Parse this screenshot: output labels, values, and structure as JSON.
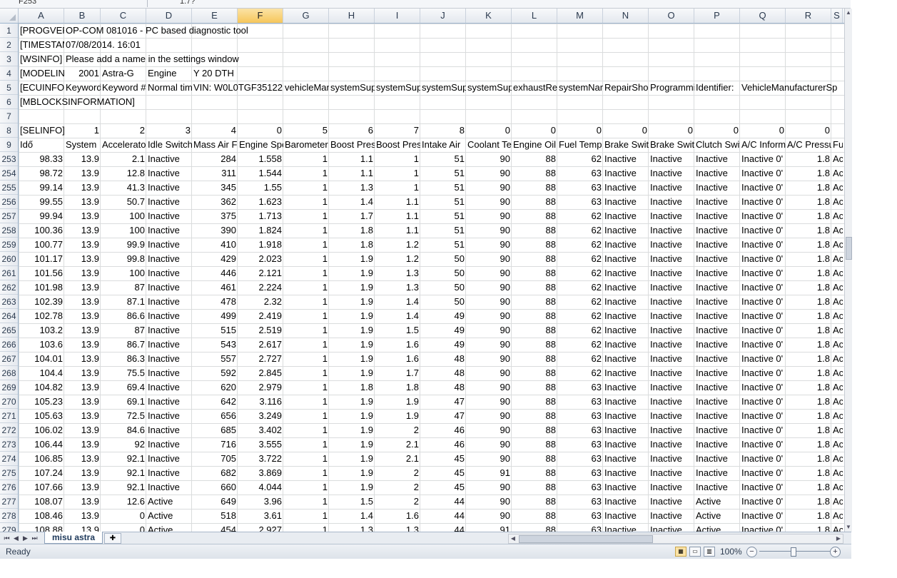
{
  "formula_bar": {
    "name_box": "F253",
    "value": "1.7?"
  },
  "columns": [
    {
      "id": "A",
      "w": 64
    },
    {
      "id": "B",
      "w": 51
    },
    {
      "id": "C",
      "w": 64
    },
    {
      "id": "D",
      "w": 64
    },
    {
      "id": "E",
      "w": 64
    },
    {
      "id": "F",
      "w": 64
    },
    {
      "id": "G",
      "w": 64
    },
    {
      "id": "H",
      "w": 64
    },
    {
      "id": "I",
      "w": 64
    },
    {
      "id": "J",
      "w": 64
    },
    {
      "id": "K",
      "w": 64
    },
    {
      "id": "L",
      "w": 64
    },
    {
      "id": "M",
      "w": 64
    },
    {
      "id": "N",
      "w": 64
    },
    {
      "id": "O",
      "w": 64
    },
    {
      "id": "P",
      "w": 64
    },
    {
      "id": "Q",
      "w": 64
    },
    {
      "id": "R",
      "w": 64
    },
    {
      "id": "S",
      "w": 16
    }
  ],
  "selected_column": "F",
  "top_rows": [
    {
      "num": "1",
      "cells": [
        {
          "col": 0,
          "v": "[PROGVERSION]",
          "t": "txt"
        },
        {
          "col": 1,
          "v": "OP-COM 081016 - PC based diagnostic tool",
          "t": "txt"
        }
      ]
    },
    {
      "num": "2",
      "cells": [
        {
          "col": 0,
          "v": "[TIMESTAMP]",
          "t": "txt"
        },
        {
          "col": 1,
          "v": "07/08/2014. 16:01",
          "t": "txt"
        }
      ]
    },
    {
      "num": "3",
      "cells": [
        {
          "col": 0,
          "v": "[WSINFO]",
          "t": "txt"
        },
        {
          "col": 1,
          "v": "Please add a name in the settings window",
          "t": "txt"
        }
      ]
    },
    {
      "num": "4",
      "cells": [
        {
          "col": 0,
          "v": "[MODELINFO]",
          "t": "txt"
        },
        {
          "col": 1,
          "v": "2001",
          "t": "num"
        },
        {
          "col": 2,
          "v": "Astra-G",
          "t": "txt"
        },
        {
          "col": 3,
          "v": "Engine",
          "t": "txt"
        },
        {
          "col": 4,
          "v": "Y 20 DTH",
          "t": "txt"
        }
      ]
    },
    {
      "num": "5",
      "cells": [
        {
          "col": 0,
          "v": "[ECUINFO]",
          "t": "txt"
        },
        {
          "col": 1,
          "v": "Keyword",
          "t": "txt"
        },
        {
          "col": 2,
          "v": "Keyword #",
          "t": "txt"
        },
        {
          "col": 3,
          "v": "Normal timing",
          "t": "txt"
        },
        {
          "col": 4,
          "v": "VIN: W0L0TGF35122",
          "t": "txt"
        },
        {
          "col": 6,
          "v": "vehicleManufacturer",
          "t": "txt"
        },
        {
          "col": 7,
          "v": "systemSupplier",
          "t": "txt"
        },
        {
          "col": 8,
          "v": "systemSupplier",
          "t": "txt"
        },
        {
          "col": 9,
          "v": "systemSupplier",
          "t": "txt"
        },
        {
          "col": 10,
          "v": "systemSupplier",
          "t": "txt"
        },
        {
          "col": 11,
          "v": "exhaustRegulation",
          "t": "txt"
        },
        {
          "col": 12,
          "v": "systemName",
          "t": "txt"
        },
        {
          "col": 13,
          "v": "RepairShopCode",
          "t": "txt"
        },
        {
          "col": 14,
          "v": "Programming",
          "t": "txt"
        },
        {
          "col": 15,
          "v": "Identifier:",
          "t": "txt"
        },
        {
          "col": 16,
          "v": "VehicleManufacturerSp",
          "t": "txt"
        }
      ]
    },
    {
      "num": "6",
      "cells": [
        {
          "col": 0,
          "v": "[MBLOCKSINFORMATION]",
          "t": "txt"
        }
      ]
    },
    {
      "num": "7",
      "cells": []
    },
    {
      "num": "8",
      "cells": [
        {
          "col": 0,
          "v": "[SELINFO]",
          "t": "txt"
        },
        {
          "col": 1,
          "v": "1",
          "t": "num"
        },
        {
          "col": 2,
          "v": "2",
          "t": "num"
        },
        {
          "col": 3,
          "v": "3",
          "t": "num"
        },
        {
          "col": 4,
          "v": "4",
          "t": "num"
        },
        {
          "col": 5,
          "v": "0",
          "t": "num"
        },
        {
          "col": 6,
          "v": "5",
          "t": "num"
        },
        {
          "col": 7,
          "v": "6",
          "t": "num"
        },
        {
          "col": 8,
          "v": "7",
          "t": "num"
        },
        {
          "col": 9,
          "v": "8",
          "t": "num"
        },
        {
          "col": 10,
          "v": "0",
          "t": "num"
        },
        {
          "col": 11,
          "v": "0",
          "t": "num"
        },
        {
          "col": 12,
          "v": "0",
          "t": "num"
        },
        {
          "col": 13,
          "v": "0",
          "t": "num"
        },
        {
          "col": 14,
          "v": "0",
          "t": "num"
        },
        {
          "col": 15,
          "v": "0",
          "t": "num"
        },
        {
          "col": 16,
          "v": "0",
          "t": "num"
        },
        {
          "col": 17,
          "v": "0",
          "t": "num"
        }
      ]
    },
    {
      "num": "9",
      "cells": [
        {
          "col": 0,
          "v": "Idő",
          "t": "txt"
        },
        {
          "col": 1,
          "v": "System",
          "t": "txt"
        },
        {
          "col": 2,
          "v": "Accelerator",
          "t": "txt"
        },
        {
          "col": 3,
          "v": "Idle Switch",
          "t": "txt"
        },
        {
          "col": 4,
          "v": "Mass Air Flow",
          "t": "txt"
        },
        {
          "col": 5,
          "v": "Engine Speed",
          "t": "txt"
        },
        {
          "col": 6,
          "v": "Barometer",
          "t": "txt"
        },
        {
          "col": 7,
          "v": "Boost Pressure",
          "t": "txt"
        },
        {
          "col": 8,
          "v": "Boost Pressure",
          "t": "txt"
        },
        {
          "col": 9,
          "v": "Intake Air",
          "t": "txt"
        },
        {
          "col": 10,
          "v": "Coolant Temp",
          "t": "txt"
        },
        {
          "col": 11,
          "v": "Engine Oil",
          "t": "txt"
        },
        {
          "col": 12,
          "v": "Fuel Temp",
          "t": "txt"
        },
        {
          "col": 13,
          "v": "Brake Switch",
          "t": "txt"
        },
        {
          "col": 14,
          "v": "Brake Switch",
          "t": "txt"
        },
        {
          "col": 15,
          "v": "Clutch Switch",
          "t": "txt"
        },
        {
          "col": 16,
          "v": "A/C Information",
          "t": "txt"
        },
        {
          "col": 17,
          "v": "A/C Pressure",
          "t": "txt"
        },
        {
          "col": 18,
          "v": "Fu",
          "t": "txt"
        }
      ]
    }
  ],
  "data_rows": [
    {
      "num": "253",
      "v": [
        "98.33",
        "13.9",
        "2.1",
        "Inactive",
        "284",
        "1.558",
        "1",
        "1.1",
        "1",
        "51",
        "90",
        "88",
        "62",
        "Inactive",
        "Inactive",
        "Inactive",
        "Inactive 0'",
        "1.8",
        "Ac"
      ]
    },
    {
      "num": "254",
      "v": [
        "98.72",
        "13.9",
        "12.8",
        "Inactive",
        "311",
        "1.544",
        "1",
        "1.1",
        "1",
        "51",
        "90",
        "88",
        "63",
        "Inactive",
        "Inactive",
        "Inactive",
        "Inactive 0'",
        "1.8",
        "Ac"
      ]
    },
    {
      "num": "255",
      "v": [
        "99.14",
        "13.9",
        "41.3",
        "Inactive",
        "345",
        "1.55",
        "1",
        "1.3",
        "1",
        "51",
        "90",
        "88",
        "63",
        "Inactive",
        "Inactive",
        "Inactive",
        "Inactive 0'",
        "1.8",
        "Ac"
      ]
    },
    {
      "num": "256",
      "v": [
        "99.55",
        "13.9",
        "50.7",
        "Inactive",
        "362",
        "1.623",
        "1",
        "1.4",
        "1.1",
        "51",
        "90",
        "88",
        "63",
        "Inactive",
        "Inactive",
        "Inactive",
        "Inactive 0'",
        "1.8",
        "Ac"
      ]
    },
    {
      "num": "257",
      "v": [
        "99.94",
        "13.9",
        "100",
        "Inactive",
        "375",
        "1.713",
        "1",
        "1.7",
        "1.1",
        "51",
        "90",
        "88",
        "62",
        "Inactive",
        "Inactive",
        "Inactive",
        "Inactive 0'",
        "1.8",
        "Ac"
      ]
    },
    {
      "num": "258",
      "v": [
        "100.36",
        "13.9",
        "100",
        "Inactive",
        "390",
        "1.824",
        "1",
        "1.8",
        "1.1",
        "51",
        "90",
        "88",
        "62",
        "Inactive",
        "Inactive",
        "Inactive",
        "Inactive 0'",
        "1.8",
        "Ac"
      ]
    },
    {
      "num": "259",
      "v": [
        "100.77",
        "13.9",
        "99.9",
        "Inactive",
        "410",
        "1.918",
        "1",
        "1.8",
        "1.2",
        "51",
        "90",
        "88",
        "62",
        "Inactive",
        "Inactive",
        "Inactive",
        "Inactive 0'",
        "1.8",
        "Ac"
      ]
    },
    {
      "num": "260",
      "v": [
        "101.17",
        "13.9",
        "99.8",
        "Inactive",
        "429",
        "2.023",
        "1",
        "1.9",
        "1.2",
        "50",
        "90",
        "88",
        "62",
        "Inactive",
        "Inactive",
        "Inactive",
        "Inactive 0'",
        "1.8",
        "Ac"
      ]
    },
    {
      "num": "261",
      "v": [
        "101.56",
        "13.9",
        "100",
        "Inactive",
        "446",
        "2.121",
        "1",
        "1.9",
        "1.3",
        "50",
        "90",
        "88",
        "62",
        "Inactive",
        "Inactive",
        "Inactive",
        "Inactive 0'",
        "1.8",
        "Ac"
      ]
    },
    {
      "num": "262",
      "v": [
        "101.98",
        "13.9",
        "87",
        "Inactive",
        "461",
        "2.224",
        "1",
        "1.9",
        "1.3",
        "50",
        "90",
        "88",
        "62",
        "Inactive",
        "Inactive",
        "Inactive",
        "Inactive 0'",
        "1.8",
        "Ac"
      ]
    },
    {
      "num": "263",
      "v": [
        "102.39",
        "13.9",
        "87.1",
        "Inactive",
        "478",
        "2.32",
        "1",
        "1.9",
        "1.4",
        "50",
        "90",
        "88",
        "62",
        "Inactive",
        "Inactive",
        "Inactive",
        "Inactive 0'",
        "1.8",
        "Ac"
      ]
    },
    {
      "num": "264",
      "v": [
        "102.78",
        "13.9",
        "86.6",
        "Inactive",
        "499",
        "2.419",
        "1",
        "1.9",
        "1.4",
        "49",
        "90",
        "88",
        "62",
        "Inactive",
        "Inactive",
        "Inactive",
        "Inactive 0'",
        "1.8",
        "Ac"
      ]
    },
    {
      "num": "265",
      "v": [
        "103.2",
        "13.9",
        "87",
        "Inactive",
        "515",
        "2.519",
        "1",
        "1.9",
        "1.5",
        "49",
        "90",
        "88",
        "62",
        "Inactive",
        "Inactive",
        "Inactive",
        "Inactive 0'",
        "1.8",
        "Ac"
      ]
    },
    {
      "num": "266",
      "v": [
        "103.6",
        "13.9",
        "86.7",
        "Inactive",
        "543",
        "2.617",
        "1",
        "1.9",
        "1.6",
        "49",
        "90",
        "88",
        "62",
        "Inactive",
        "Inactive",
        "Inactive",
        "Inactive 0'",
        "1.8",
        "Ac"
      ]
    },
    {
      "num": "267",
      "v": [
        "104.01",
        "13.9",
        "86.3",
        "Inactive",
        "557",
        "2.727",
        "1",
        "1.9",
        "1.6",
        "48",
        "90",
        "88",
        "62",
        "Inactive",
        "Inactive",
        "Inactive",
        "Inactive 0'",
        "1.8",
        "Ac"
      ]
    },
    {
      "num": "268",
      "v": [
        "104.4",
        "13.9",
        "75.5",
        "Inactive",
        "592",
        "2.845",
        "1",
        "1.9",
        "1.7",
        "48",
        "90",
        "88",
        "62",
        "Inactive",
        "Inactive",
        "Inactive",
        "Inactive 0'",
        "1.8",
        "Ac"
      ]
    },
    {
      "num": "269",
      "v": [
        "104.82",
        "13.9",
        "69.4",
        "Inactive",
        "620",
        "2.979",
        "1",
        "1.8",
        "1.8",
        "48",
        "90",
        "88",
        "63",
        "Inactive",
        "Inactive",
        "Inactive",
        "Inactive 0'",
        "1.8",
        "Ac"
      ]
    },
    {
      "num": "270",
      "v": [
        "105.23",
        "13.9",
        "69.1",
        "Inactive",
        "642",
        "3.116",
        "1",
        "1.9",
        "1.9",
        "47",
        "90",
        "88",
        "63",
        "Inactive",
        "Inactive",
        "Inactive",
        "Inactive 0'",
        "1.8",
        "Ac"
      ]
    },
    {
      "num": "271",
      "v": [
        "105.63",
        "13.9",
        "72.5",
        "Inactive",
        "656",
        "3.249",
        "1",
        "1.9",
        "1.9",
        "47",
        "90",
        "88",
        "63",
        "Inactive",
        "Inactive",
        "Inactive",
        "Inactive 0'",
        "1.8",
        "Ac"
      ]
    },
    {
      "num": "272",
      "v": [
        "106.02",
        "13.9",
        "84.6",
        "Inactive",
        "685",
        "3.402",
        "1",
        "1.9",
        "2",
        "46",
        "90",
        "88",
        "63",
        "Inactive",
        "Inactive",
        "Inactive",
        "Inactive 0'",
        "1.8",
        "Ac"
      ]
    },
    {
      "num": "273",
      "v": [
        "106.44",
        "13.9",
        "92",
        "Inactive",
        "716",
        "3.555",
        "1",
        "1.9",
        "2.1",
        "46",
        "90",
        "88",
        "63",
        "Inactive",
        "Inactive",
        "Inactive",
        "Inactive 0'",
        "1.8",
        "Ac"
      ]
    },
    {
      "num": "274",
      "v": [
        "106.85",
        "13.9",
        "92.1",
        "Inactive",
        "705",
        "3.722",
        "1",
        "1.9",
        "2.1",
        "45",
        "90",
        "88",
        "63",
        "Inactive",
        "Inactive",
        "Inactive",
        "Inactive 0'",
        "1.8",
        "Ac"
      ]
    },
    {
      "num": "275",
      "v": [
        "107.24",
        "13.9",
        "92.1",
        "Inactive",
        "682",
        "3.869",
        "1",
        "1.9",
        "2",
        "45",
        "91",
        "88",
        "63",
        "Inactive",
        "Inactive",
        "Inactive",
        "Inactive 0'",
        "1.8",
        "Ac"
      ]
    },
    {
      "num": "276",
      "v": [
        "107.66",
        "13.9",
        "92.1",
        "Inactive",
        "660",
        "4.044",
        "1",
        "1.9",
        "2",
        "45",
        "90",
        "88",
        "63",
        "Inactive",
        "Inactive",
        "Inactive",
        "Inactive 0'",
        "1.8",
        "Ac"
      ]
    },
    {
      "num": "277",
      "v": [
        "108.07",
        "13.9",
        "12.6",
        "Active",
        "649",
        "3.96",
        "1",
        "1.5",
        "2",
        "44",
        "90",
        "88",
        "63",
        "Inactive",
        "Inactive",
        "Active",
        "Inactive 0'",
        "1.8",
        "Ac"
      ]
    },
    {
      "num": "278",
      "v": [
        "108.46",
        "13.9",
        "0",
        "Active",
        "518",
        "3.61",
        "1",
        "1.4",
        "1.6",
        "44",
        "90",
        "88",
        "63",
        "Inactive",
        "Inactive",
        "Active",
        "Inactive 0'",
        "1.8",
        "Ac"
      ]
    },
    {
      "num": "279",
      "v": [
        "108.88",
        "13.9",
        "0",
        "Active",
        "454",
        "2.927",
        "1",
        "1.3",
        "1.3",
        "44",
        "91",
        "88",
        "63",
        "Inactive",
        "Inactive",
        "Active",
        "Inactive 0'",
        "1.8",
        "Ac"
      ]
    }
  ],
  "text_columns": [
    3,
    13,
    14,
    15,
    16,
    18
  ],
  "sheet_tab": {
    "name": "misu astra"
  },
  "status_bar": {
    "status": "Ready",
    "zoom": "100%"
  }
}
